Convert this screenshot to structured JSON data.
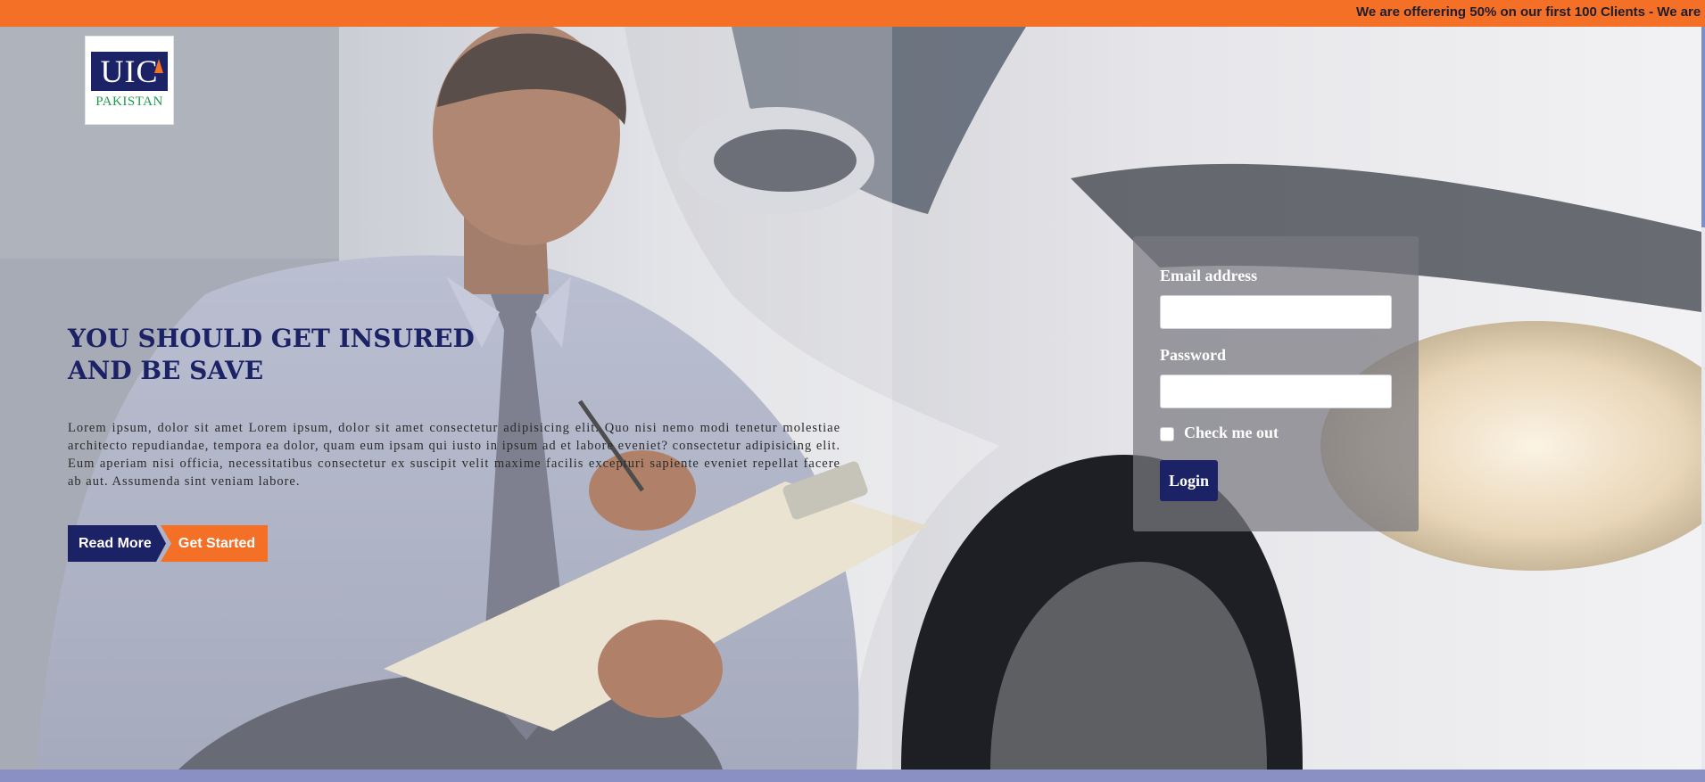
{
  "topbar": {
    "marquee_text": "We are offerering 50% on our first 100 Clients - We are",
    "color": "#f47027"
  },
  "logo": {
    "main_text": "UIC",
    "sub_text": "PAKISTAN"
  },
  "hero": {
    "headline_line1": "YOU SHOULD GET INSURED",
    "headline_line2": "AND BE SAVE",
    "lead_text": "Lorem ipsum, dolor sit amet Lorem ipsum, dolor sit amet consectetur adipisicing elit. Quo nisi nemo modi tenetur molestiae architecto repudiandae, tempora ea dolor, quam eum ipsam qui iusto in ipsum ad et labore eveniet? consectetur adipisicing elit. Eum aperiam nisi officia, necessitatibus consectetur ex suscipit velit maxime facilis excepturi sapiente eveniet repellat facere ab aut. Assumenda sint veniam labore.",
    "read_more_label": "Read More",
    "get_started_label": "Get Started"
  },
  "login": {
    "email_label": "Email address",
    "email_value": "",
    "password_label": "Password",
    "password_value": "",
    "check_label": "Check me out",
    "check_checked": false,
    "submit_label": "Login"
  },
  "colors": {
    "brand_navy": "#1b2266",
    "brand_orange": "#f47027",
    "logo_green": "#1f9a4a"
  }
}
